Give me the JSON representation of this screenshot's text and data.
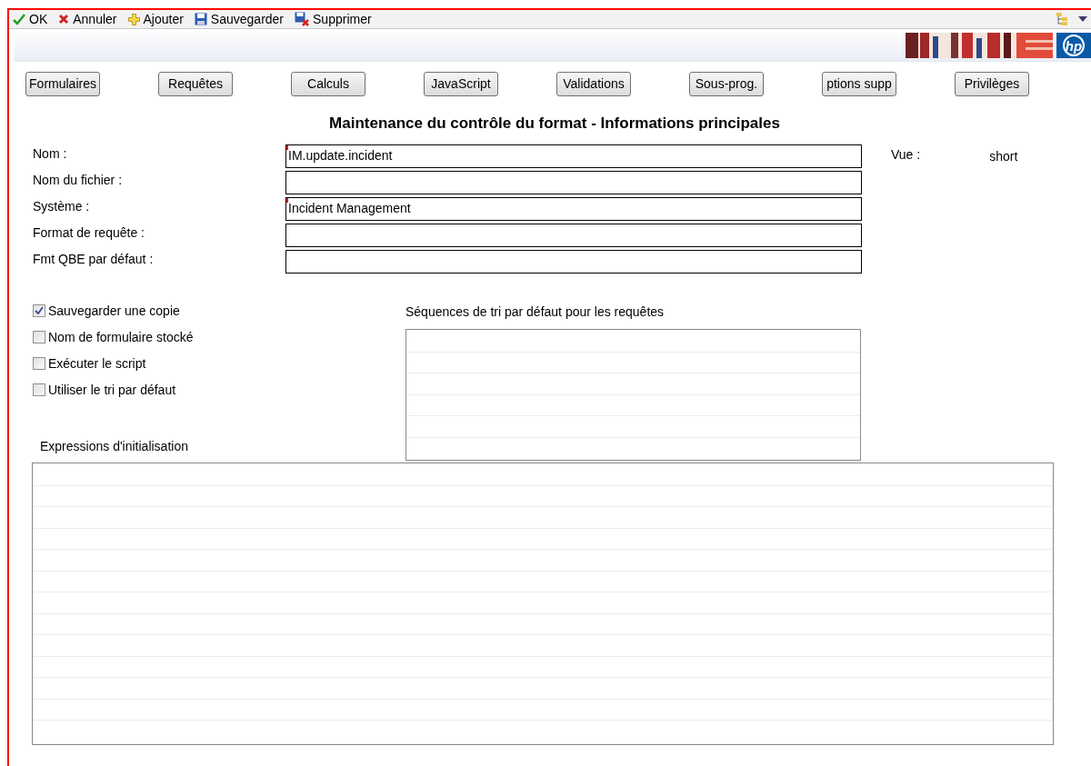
{
  "toolbar": [
    {
      "kind": "ok",
      "label": "OK"
    },
    {
      "kind": "cancel",
      "label": "Annuler"
    },
    {
      "kind": "add",
      "label": "Ajouter"
    },
    {
      "kind": "save",
      "label": "Sauvegarder"
    },
    {
      "kind": "delete",
      "label": "Supprimer"
    }
  ],
  "logo": {
    "text": "hp"
  },
  "tabs": [
    "Formulaires",
    "Requêtes",
    "Calculs",
    "JavaScript",
    "Validations",
    "Sous-prog.",
    "ptions supp",
    "Privilèges"
  ],
  "title": "Maintenance du contrôle du format - Informations principales",
  "fields": [
    {
      "label": "Nom :",
      "value": "IM.update.incident",
      "required": true
    },
    {
      "label": "Nom du fichier :",
      "required": false
    },
    {
      "label": "Système :",
      "value": "Incident Management",
      "required": true
    },
    {
      "label": "Format de requête :",
      "required": false
    },
    {
      "label": "Fmt QBE par défaut :",
      "required": false
    }
  ],
  "view": {
    "label": "Vue :",
    "value": "short"
  },
  "checkboxes": [
    {
      "label": "Sauvegarder une copie",
      "checked": true
    },
    {
      "label": "Nom de formulaire stocké",
      "checked": false
    },
    {
      "label": "Exécuter le script",
      "checked": false
    },
    {
      "label": "Utiliser le tri par défaut",
      "checked": false
    }
  ],
  "sort_sequences": {
    "label": "Séquences de tri par défaut pour les requêtes"
  },
  "init_expressions": {
    "label": "Expressions d'initialisation"
  }
}
